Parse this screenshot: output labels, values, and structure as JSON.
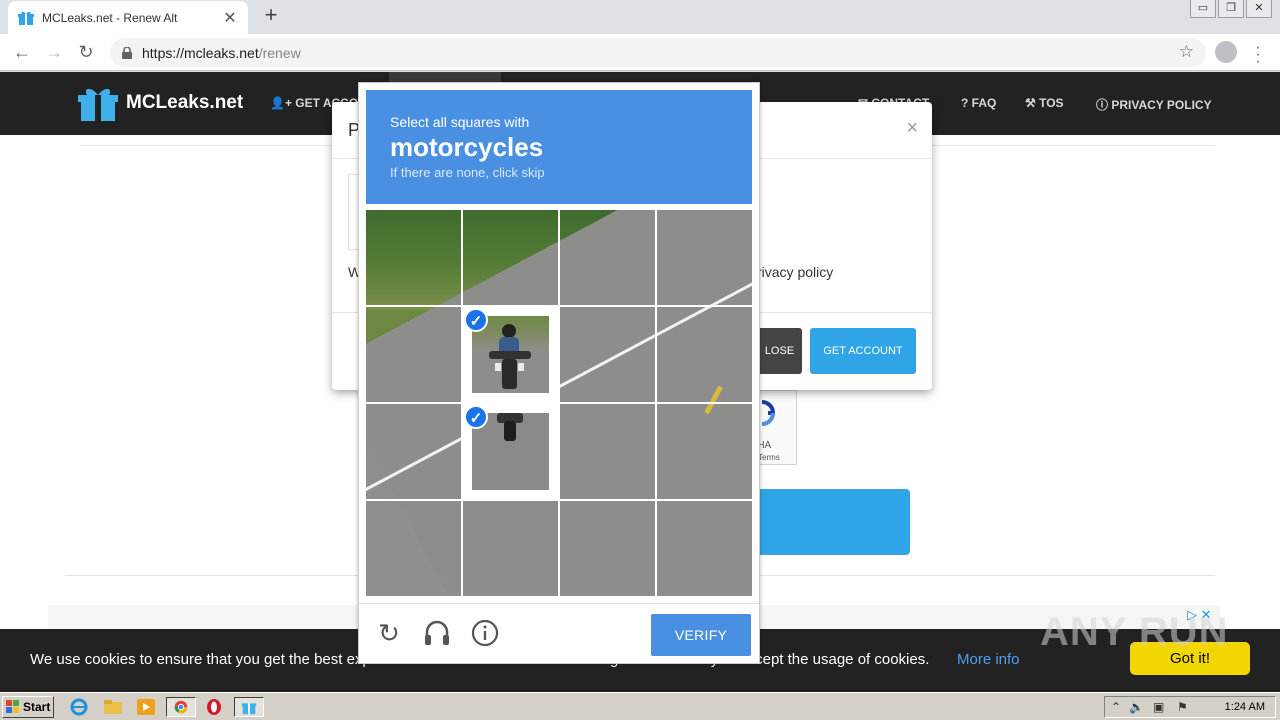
{
  "browser": {
    "tab_title": "MCLeaks.net - Renew Alt",
    "tab_close": "✕",
    "new_tab": "+",
    "url_host": "https://mcleaks.net",
    "url_path": "/renew",
    "window_controls": [
      "▭",
      "❐",
      "✕"
    ]
  },
  "site": {
    "brand": "MCLeaks.net",
    "nav_left": "GET ACCO",
    "nav_contact": "CONTACT",
    "nav_faq": "? FAQ",
    "nav_tos": "TOS",
    "nav_privacy": "PRIVACY POLICY"
  },
  "modal": {
    "header": "P",
    "close": "×",
    "text_left": "W",
    "text_right": "rivacy policy",
    "close_button": "LOSE",
    "get_account_button": "GET ACCOUNT"
  },
  "recaptcha_widget": {
    "label1": "TCHA",
    "label2": "Terms"
  },
  "captcha": {
    "instruction": "Select all squares with",
    "target": "motorcycles",
    "hint": "If there are none, click skip",
    "verify_label": "VERIFY",
    "selected_cells": [
      [
        1,
        1
      ],
      [
        2,
        1
      ]
    ],
    "grid_size": 4
  },
  "cookie_bar": {
    "text": "We use cookies to ensure that you get the best experience on MCLeaks. While browsing on MCLeaks you accept the usage of cookies.",
    "link": "More info",
    "button": "Got it!"
  },
  "ad": {
    "icons": "▷ ✕"
  },
  "watermark": "ANY RUN",
  "taskbar": {
    "start": "Start",
    "clock": "1:24 AM"
  },
  "colors": {
    "captcha_blue": "#4a90e2",
    "site_nav": "#222222",
    "accent_blue": "#2fa4e7",
    "cookie_button": "#f1d600"
  }
}
